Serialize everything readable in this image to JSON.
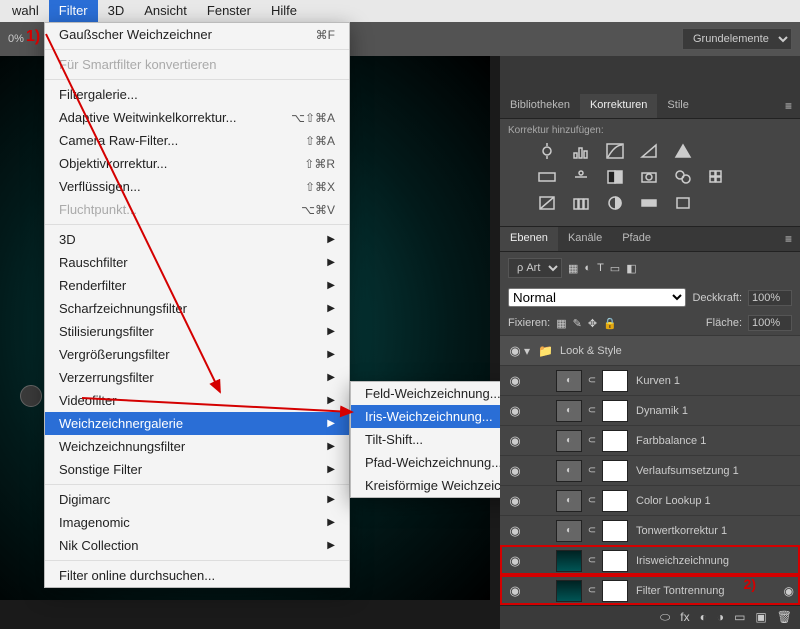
{
  "menubar": {
    "items": [
      "wahl",
      "Filter",
      "3D",
      "Ansicht",
      "Fenster",
      "Hilfe"
    ],
    "active_index": 1
  },
  "toolbar": {
    "zoom": "0%",
    "preset_label": "Grundelemente"
  },
  "dropdown": {
    "top_item": {
      "label": "Gaußscher Weichzeichner",
      "shortcut": "⌘F"
    },
    "convert": "Für Smartfilter konvertieren",
    "group1": [
      {
        "label": "Filtergalerie..."
      },
      {
        "label": "Adaptive Weitwinkelkorrektur...",
        "shortcut": "⌥⇧⌘A"
      },
      {
        "label": "Camera Raw-Filter...",
        "shortcut": "⇧⌘A"
      },
      {
        "label": "Objektivkorrektur...",
        "shortcut": "⇧⌘R"
      },
      {
        "label": "Verflüssigen...",
        "shortcut": "⇧⌘X"
      },
      {
        "label": "Fluchtpunkt...",
        "shortcut": "⌥⌘V",
        "disabled": true
      }
    ],
    "group2": [
      "3D",
      "Rauschfilter",
      "Renderfilter",
      "Scharfzeichnungsfilter",
      "Stilisierungsfilter",
      "Vergrößerungsfilter",
      "Verzerrungsfilter",
      "Videofilter",
      "Weichzeichnergalerie",
      "Weichzeichnungsfilter",
      "Sonstige Filter"
    ],
    "group2_hi": 8,
    "group3": [
      "Digimarc",
      "Imagenomic",
      "Nik Collection"
    ],
    "last": "Filter online durchsuchen..."
  },
  "submenu": {
    "items": [
      "Feld-Weichzeichnung...",
      "Iris-Weichzeichnung...",
      "Tilt-Shift...",
      "Pfad-Weichzeichnung...",
      "Kreisförmige Weichzeichnung..."
    ],
    "hi": 1
  },
  "panels": {
    "tabs1": [
      "Bibliotheken",
      "Korrekturen",
      "Stile"
    ],
    "tabs1_active": 1,
    "kor_title": "Korrektur hinzufügen:",
    "tabs2": [
      "Ebenen",
      "Kanäle",
      "Pfade"
    ],
    "tabs2_active": 0,
    "kind": "Art",
    "blend": "Normal",
    "opacity_label": "Deckkraft:",
    "opacity_value": "100%",
    "lock_label": "Fixieren:",
    "fill_label": "Fläche:",
    "fill_value": "100%"
  },
  "layers": {
    "group_name": "Look & Style",
    "items": [
      {
        "name": "Kurven 1"
      },
      {
        "name": "Dynamik 1"
      },
      {
        "name": "Farbbalance 1"
      },
      {
        "name": "Verlaufsumsetzung 1"
      },
      {
        "name": "Color Lookup 1"
      },
      {
        "name": "Tonwertkorrektur 1"
      },
      {
        "name": "Irisweichzeichnung",
        "selected": true,
        "img": true
      },
      {
        "name": "Filter Tontrennung",
        "smart": true,
        "img": true
      }
    ]
  },
  "anno": {
    "one": "1)",
    "two": "2)"
  }
}
